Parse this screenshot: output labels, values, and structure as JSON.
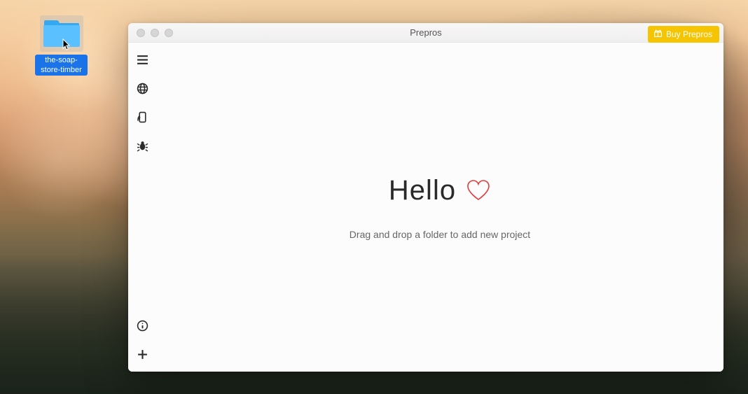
{
  "desktop": {
    "folder_name": "the-soap-store-timber"
  },
  "window": {
    "title": "Prepros",
    "buy_label": "Buy Prepros"
  },
  "sidebar": {
    "icons": {
      "menu": "menu-icon",
      "globe": "globe-icon",
      "device": "device-icon",
      "bug": "bug-icon",
      "info": "info-icon",
      "add": "add-icon"
    }
  },
  "main": {
    "greeting": "Hello",
    "instruction": "Drag and drop a folder to add new project"
  }
}
